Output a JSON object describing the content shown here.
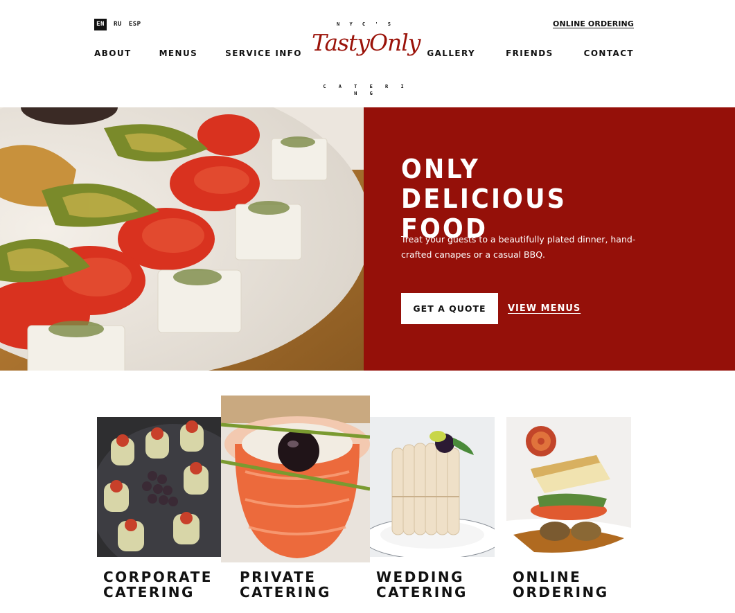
{
  "languages": [
    {
      "label": "EN",
      "active": true
    },
    {
      "label": "RU",
      "active": false
    },
    {
      "label": "ESP",
      "active": false
    }
  ],
  "header": {
    "online_ordering": "ONLINE ORDERING",
    "logo": {
      "top": "N Y C ' S",
      "script": "TastyOnly",
      "bottom": "C A T E R I N G"
    },
    "nav_left": [
      "ABOUT",
      "MENUS",
      "SERVICE INFO"
    ],
    "nav_right": [
      "GALLERY",
      "FRIENDS",
      "CONTACT"
    ]
  },
  "hero": {
    "title_line1": "ONLY DELICIOUS",
    "title_line2": "FOOD",
    "text": "Treat your guests to a beautifully plated dinner, hand-crafted canapes or a casual BBQ.",
    "quote_button": "GET A QUOTE",
    "menus_link": "VIEW MENUS"
  },
  "services": [
    {
      "title": "CORPORATE\nCATERING"
    },
    {
      "title": "PRIVATE\nCATERING"
    },
    {
      "title": "WEDDING\nCATERING"
    },
    {
      "title": "ONLINE\nORDERING"
    }
  ],
  "colors": {
    "accent": "#951009",
    "logo": "#9a1209",
    "text": "#111111"
  }
}
